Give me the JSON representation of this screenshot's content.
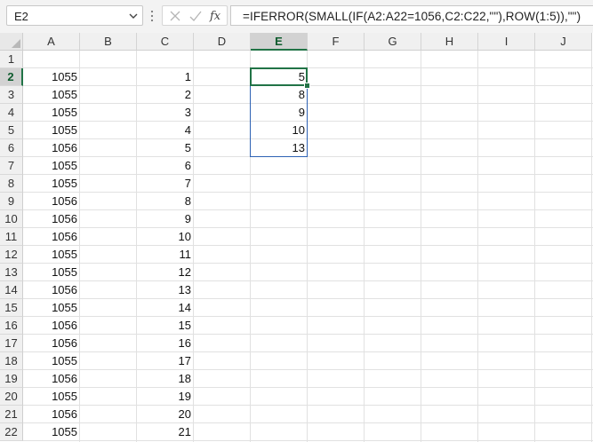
{
  "name_box": {
    "value": "E2"
  },
  "formula_bar": {
    "formula": "=IFERROR(SMALL(IF(A2:A22=1056,C2:C22,\"\"),ROW(1:5)),\"\")"
  },
  "columns": [
    "A",
    "B",
    "C",
    "D",
    "E",
    "F",
    "G",
    "H",
    "I",
    "J"
  ],
  "selected_column": "E",
  "rows": [
    {
      "row": "1",
      "A": "",
      "C": "",
      "E": ""
    },
    {
      "row": "2",
      "A": "1055",
      "C": "1",
      "E": "5"
    },
    {
      "row": "3",
      "A": "1055",
      "C": "2",
      "E": "8"
    },
    {
      "row": "4",
      "A": "1055",
      "C": "3",
      "E": "9"
    },
    {
      "row": "5",
      "A": "1055",
      "C": "4",
      "E": "10"
    },
    {
      "row": "6",
      "A": "1056",
      "C": "5",
      "E": "13"
    },
    {
      "row": "7",
      "A": "1055",
      "C": "6",
      "E": ""
    },
    {
      "row": "8",
      "A": "1055",
      "C": "7",
      "E": ""
    },
    {
      "row": "9",
      "A": "1056",
      "C": "8",
      "E": ""
    },
    {
      "row": "10",
      "A": "1056",
      "C": "9",
      "E": ""
    },
    {
      "row": "11",
      "A": "1056",
      "C": "10",
      "E": ""
    },
    {
      "row": "12",
      "A": "1055",
      "C": "11",
      "E": ""
    },
    {
      "row": "13",
      "A": "1055",
      "C": "12",
      "E": ""
    },
    {
      "row": "14",
      "A": "1056",
      "C": "13",
      "E": ""
    },
    {
      "row": "15",
      "A": "1055",
      "C": "14",
      "E": ""
    },
    {
      "row": "16",
      "A": "1056",
      "C": "15",
      "E": ""
    },
    {
      "row": "17",
      "A": "1056",
      "C": "16",
      "E": ""
    },
    {
      "row": "18",
      "A": "1055",
      "C": "17",
      "E": ""
    },
    {
      "row": "19",
      "A": "1056",
      "C": "18",
      "E": ""
    },
    {
      "row": "20",
      "A": "1055",
      "C": "19",
      "E": ""
    },
    {
      "row": "21",
      "A": "1056",
      "C": "20",
      "E": ""
    },
    {
      "row": "22",
      "A": "1055",
      "C": "21",
      "E": ""
    }
  ],
  "colors": {
    "accent": "#217346",
    "spill_border": "#2e62b4",
    "gridline": "#e1e1e1"
  },
  "icons": {
    "name_box_dropdown": "chevron-down-icon",
    "options": "vertical-dots-icon",
    "cancel": "x-icon",
    "enter": "checkmark-icon",
    "insert_function": "fx-icon",
    "select_all": "triangle-icon"
  }
}
